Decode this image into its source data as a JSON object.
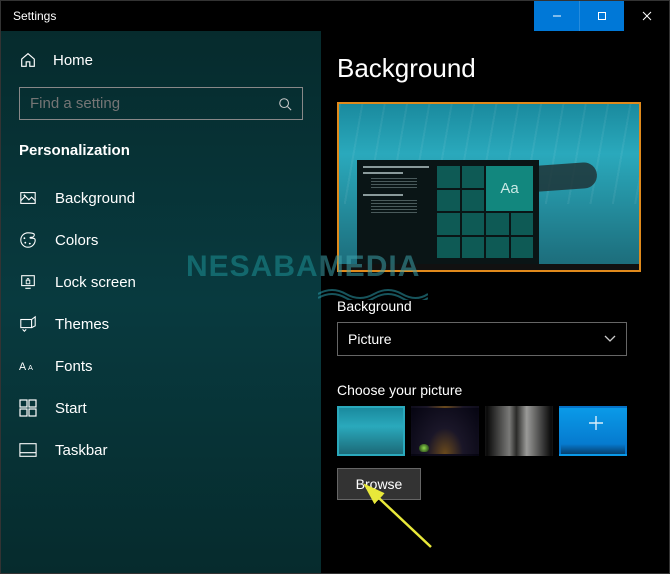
{
  "window": {
    "title": "Settings"
  },
  "sidebar": {
    "home": "Home",
    "search_placeholder": "Find a setting",
    "section": "Personalization",
    "items": [
      {
        "label": "Background"
      },
      {
        "label": "Colors"
      },
      {
        "label": "Lock screen"
      },
      {
        "label": "Themes"
      },
      {
        "label": "Fonts"
      },
      {
        "label": "Start"
      },
      {
        "label": "Taskbar"
      }
    ]
  },
  "content": {
    "heading": "Background",
    "preview_sample_text": "Aa",
    "bg_label": "Background",
    "bg_dropdown_value": "Picture",
    "choose_label": "Choose your picture",
    "browse": "Browse"
  },
  "colors": {
    "accent": "#0078d7",
    "highlight_border": "#e08a1c",
    "teal": "#12877e"
  },
  "watermark": {
    "part1": "NESABA",
    "part2": "MEDIA"
  }
}
